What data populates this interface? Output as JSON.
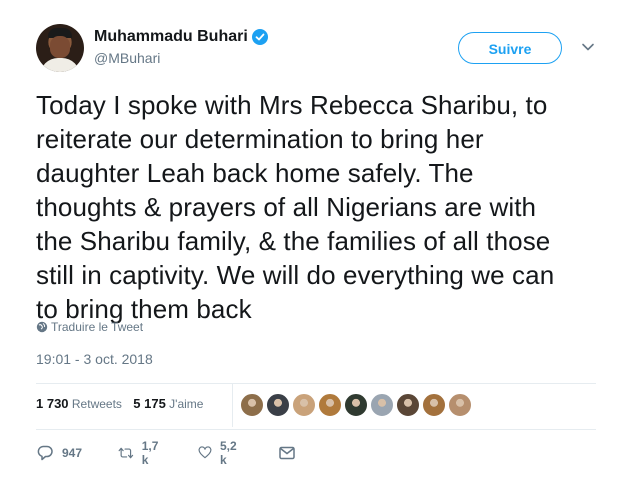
{
  "user": {
    "name": "Muhammadu Buhari",
    "handle": "@MBuhari",
    "verified": true
  },
  "follow_button": {
    "label": "Suivre"
  },
  "tweet": {
    "lines": [
      "Today I spoke with Mrs Rebecca Sharibu, to",
      "reiterate our determination to bring her",
      "daughter Leah back home safely. The",
      "thoughts & prayers of all Nigerians are with",
      "the Sharibu family, & the families of all those",
      "still in captivity. We will do everything we can",
      "to bring them back"
    ],
    "translate_label": "Traduire le Tweet",
    "timestamp": "19:01 - 3 oct. 2018"
  },
  "stats": {
    "retweets_count": "1 730",
    "retweets_label": "Retweets",
    "likes_count": "5 175",
    "likes_label": "J'aime"
  },
  "likers": [
    {
      "name": "liker-1",
      "color": "#8d6e4a"
    },
    {
      "name": "liker-2",
      "color": "#3a3f47"
    },
    {
      "name": "liker-3",
      "color": "#c9a27a"
    },
    {
      "name": "liker-4",
      "color": "#b07a3c"
    },
    {
      "name": "liker-5",
      "color": "#2f3a30"
    },
    {
      "name": "liker-6",
      "color": "#9aa5b1"
    },
    {
      "name": "liker-7",
      "color": "#5a4636"
    },
    {
      "name": "liker-8",
      "color": "#a3713d"
    },
    {
      "name": "liker-9",
      "color": "#b68f6e"
    }
  ],
  "actions": {
    "replies": "947",
    "retweets": "1,7 k",
    "likes": "5,2 k"
  },
  "colors": {
    "accent": "#1da1f2",
    "text": "#14171a",
    "secondary": "#657786",
    "divider": "#e6ecf0"
  }
}
